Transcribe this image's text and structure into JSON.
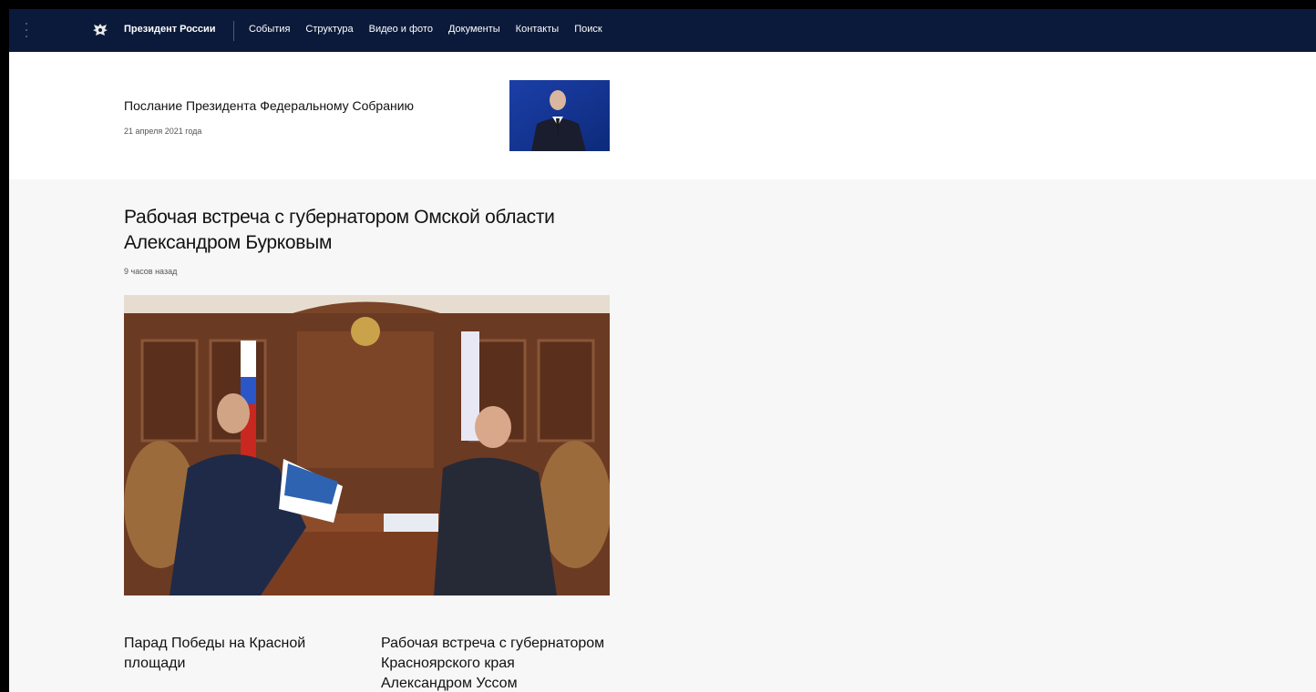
{
  "header": {
    "site_title": "Президент России",
    "nav": [
      "События",
      "Структура",
      "Видео и фото",
      "Документы",
      "Контакты",
      "Поиск"
    ]
  },
  "feature": {
    "title": "Послание Президента Федеральному Собранию",
    "date": "21 апреля 2021 года"
  },
  "main": {
    "title": "Рабочая встреча с губернатором Омской области Александром Бурковым",
    "time": "9 часов назад"
  },
  "more": [
    {
      "title": "Парад Победы на Красной площади"
    },
    {
      "title": "Рабочая встреча с губернатором Красноярского края Александром Уссом"
    }
  ],
  "colors": {
    "header_bg": "#0b1a3a",
    "page_bg": "#f7f7f7"
  }
}
